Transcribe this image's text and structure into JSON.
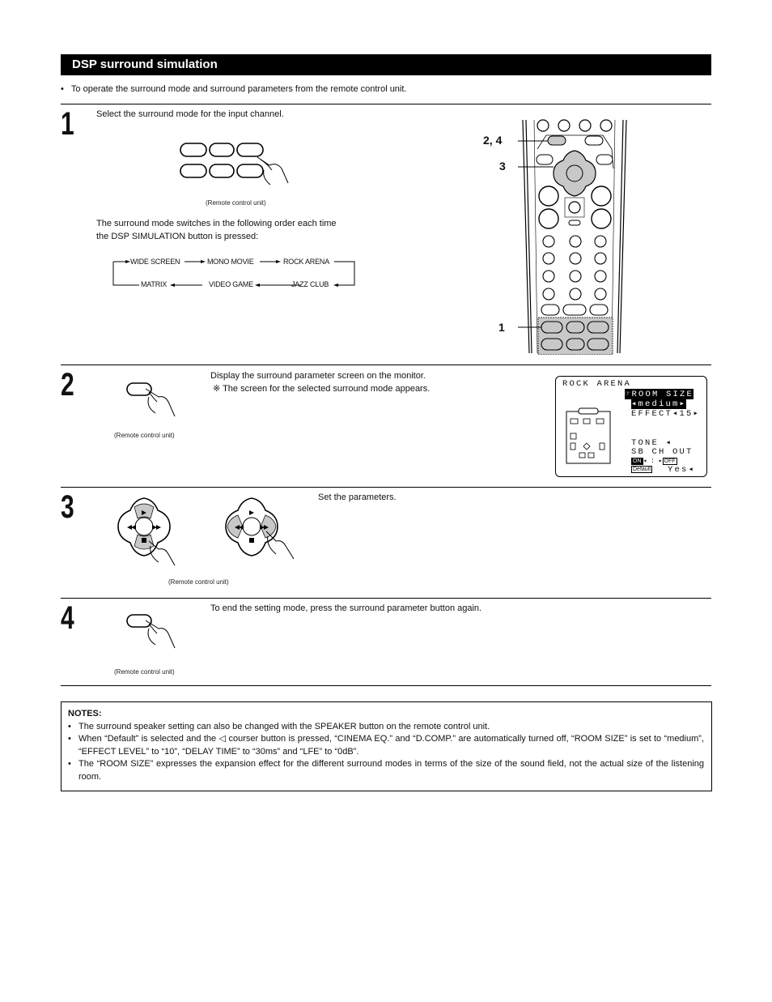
{
  "header": {
    "title": "DSP surround simulation"
  },
  "intro": "To operate the surround mode and surround parameters from the remote control unit.",
  "bullet": "•",
  "steps": [
    {
      "number": "1",
      "text": "Select the surround mode for the input channel.",
      "caption": "(Remote control unit)",
      "sequence_text_1": "The surround mode switches in the following order each time",
      "sequence_text_2": "the DSP SIMULATION button is pressed:",
      "modes_top": [
        "WIDE SCREEN",
        "MONO MOVIE",
        "ROCK ARENA"
      ],
      "modes_bottom": [
        "MATRIX",
        "VIDEO GAME",
        "JAZZ CLUB"
      ]
    },
    {
      "number": "2",
      "text": "Display the surround parameter screen on the monitor.",
      "note": "※ The screen for the selected surround mode appears.",
      "caption": "(Remote control unit)"
    },
    {
      "number": "3",
      "text": "Set the parameters.",
      "caption": "(Remote control unit)"
    },
    {
      "number": "4",
      "text": "To end the setting mode, press the surround parameter button again.",
      "caption": "(Remote control unit)"
    }
  ],
  "remote": {
    "callouts": [
      "2, 4",
      "3",
      "1"
    ],
    "highlight_color": "#c8c8c8"
  },
  "osd": {
    "mode": "ROCK ARENA",
    "cursor_icon": "☞",
    "room_size_label": "ROOM SIZE",
    "room_size_value": "◂medium▸",
    "effect": "EFFECT◂15▸",
    "tone": "TONE ◂",
    "sb_ch_out": "SB CH OUT",
    "on": "ON",
    "arrows": "◂ : ▸",
    "off": "OFF",
    "default": "Default",
    "yes": "Yes◂"
  },
  "notes": {
    "title": "NOTES:",
    "items": [
      "The surround speaker setting can also be changed with the SPEAKER button on the remote control unit.",
      "When “Default” is selected and the ◁ courser button is pressed, “CINEMA EQ.” and “D.COMP.” are automatically turned off, “ROOM SIZE” is set to “medium”, “EFFECT LEVEL” to “10”, “DELAY TIME” to “30ms” and “LFE” to “0dB”.",
      "The “ROOM SIZE” expresses the expansion effect for the different surround modes in terms of the size of the sound field, not the actual size of the listening room."
    ]
  }
}
